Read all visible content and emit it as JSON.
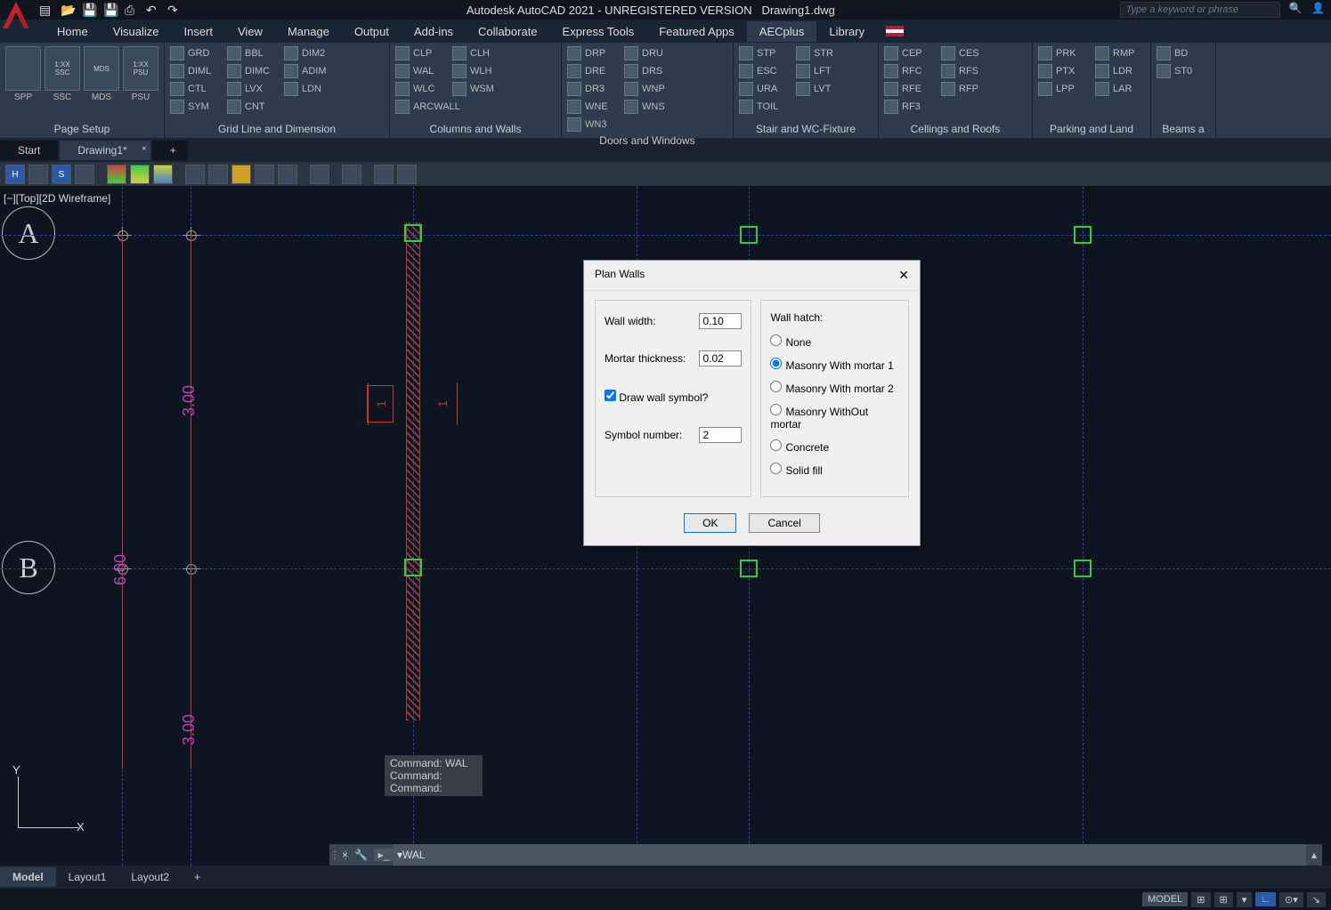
{
  "title": {
    "app": "Autodesk AutoCAD 2021 - UNREGISTERED VERSION",
    "file": "Drawing1.dwg"
  },
  "search": {
    "placeholder": "Type a keyword or phrase"
  },
  "menu": [
    "Home",
    "Visualize",
    "Insert",
    "View",
    "Manage",
    "Output",
    "Add-ins",
    "Collaborate",
    "Express Tools",
    "Featured Apps",
    "AECplus",
    "Library"
  ],
  "menu_active": 10,
  "ribbon": {
    "panels": [
      {
        "title": "Page Setup",
        "big": [
          "SPP",
          "SSC",
          "MDS",
          "PSU"
        ],
        "bigtop": [
          "",
          "1:XX\nSSC",
          "MDS",
          "1:XX\nPSU"
        ]
      },
      {
        "title": "Grid Line and Dimension",
        "tools": [
          "GRD",
          "BBL",
          "DIM2",
          "DIML",
          "DIMC",
          "ADIM",
          "CTL",
          "LVX",
          "LDN",
          "SYM",
          "CNT"
        ]
      },
      {
        "title": "Columns and Walls",
        "tools": [
          "CLP",
          "CLH",
          "WAL",
          "WLH",
          "WLC",
          "WSM",
          "ARCWALL"
        ]
      },
      {
        "title": "Doors and Windows",
        "tools": [
          "DRP",
          "DRU",
          "DRE",
          "DRS",
          "DR3",
          "WNP",
          "WNE",
          "WNS",
          "WN3"
        ]
      },
      {
        "title": "Stair and WC-Fixture",
        "tools": [
          "STP",
          "STR",
          "ESC",
          "LFT",
          "URA",
          "LVT",
          "TOIL"
        ]
      },
      {
        "title": "Cellings and Roofs",
        "tools": [
          "CEP",
          "CES",
          "RFC",
          "RFS",
          "RFE",
          "RFP",
          "RF3"
        ]
      },
      {
        "title": "Parking and Land",
        "tools": [
          "PRK",
          "RMP",
          "PTX",
          "LDR",
          "LPP",
          "LAR"
        ]
      },
      {
        "title": "Beams a",
        "tools": [
          "BD",
          "ST0"
        ]
      }
    ]
  },
  "file_tabs": {
    "items": [
      "Start",
      "Drawing1*"
    ],
    "active": 1
  },
  "view_label": "[−][Top][2D Wireframe]",
  "grid_labels": {
    "a": "A",
    "b": "B"
  },
  "dims": {
    "d1": "3.00",
    "d2": "6.00",
    "d3": "3.00"
  },
  "cmd_history": [
    "Command: WAL",
    "Command:",
    "Command:"
  ],
  "cmd_input": "WAL",
  "dialog": {
    "title": "Plan Walls",
    "wall_width_lbl": "Wall width:",
    "wall_width": "0.10",
    "mortar_lbl": "Mortar thickness:",
    "mortar": "0.02",
    "draw_symbol_lbl": "Draw wall symbol?",
    "draw_symbol": true,
    "symbol_num_lbl": "Symbol number:",
    "symbol_num": "2",
    "hatch_lbl": "Wall hatch:",
    "hatch_options": [
      "None",
      "Masonry With mortar 1",
      "Masonry With mortar 2",
      "Masonry WithOut mortar",
      "Concrete",
      "Solid fill"
    ],
    "hatch_selected": 1,
    "ok": "OK",
    "cancel": "Cancel"
  },
  "layout_tabs": {
    "items": [
      "Model",
      "Layout1",
      "Layout2"
    ],
    "active": 0
  },
  "status": {
    "model": "MODEL"
  },
  "ucs": {
    "x": "X",
    "y": "Y"
  },
  "arrow_labels": {
    "left": "1",
    "right": "1"
  }
}
